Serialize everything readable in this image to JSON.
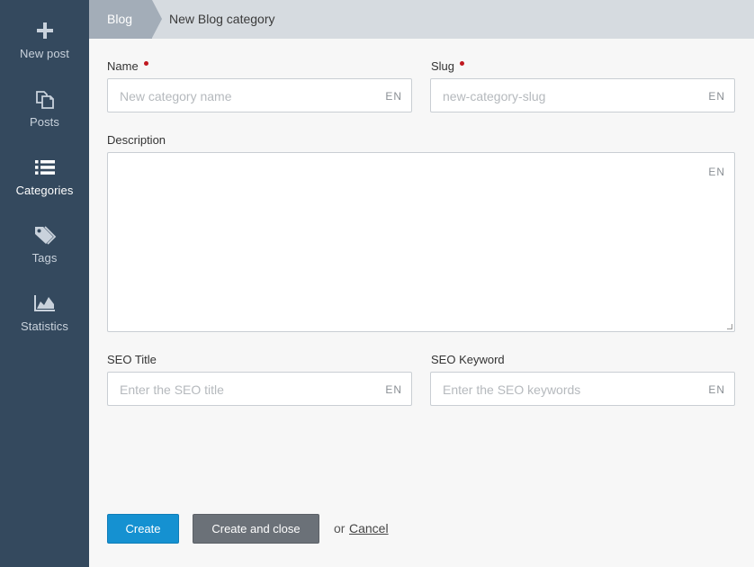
{
  "sidebar": {
    "items": [
      {
        "label": "New post",
        "icon": "plus-icon"
      },
      {
        "label": "Posts",
        "icon": "posts-icon"
      },
      {
        "label": "Categories",
        "icon": "list-icon",
        "active": true
      },
      {
        "label": "Tags",
        "icon": "tags-icon"
      },
      {
        "label": "Statistics",
        "icon": "area-chart-icon"
      }
    ]
  },
  "breadcrumb": {
    "parent": "Blog",
    "current": "New Blog category"
  },
  "form": {
    "name": {
      "label": "Name",
      "placeholder": "New category name",
      "lang": "EN",
      "required": true
    },
    "slug": {
      "label": "Slug",
      "placeholder": "new-category-slug",
      "lang": "EN",
      "required": true
    },
    "description": {
      "label": "Description",
      "lang": "EN"
    },
    "seo_title": {
      "label": "SEO Title",
      "placeholder": "Enter the SEO title",
      "lang": "EN"
    },
    "seo_keyword": {
      "label": "SEO Keyword",
      "placeholder": "Enter the SEO keywords",
      "lang": "EN"
    }
  },
  "actions": {
    "create_label": "Create",
    "create_close_label": "Create and close",
    "or_text": "or",
    "cancel_label": "Cancel"
  },
  "colors": {
    "sidebar_bg": "#34495e",
    "primary_button": "#1591d1",
    "secondary_button": "#6b7178",
    "required_dot": "#c0181f"
  }
}
